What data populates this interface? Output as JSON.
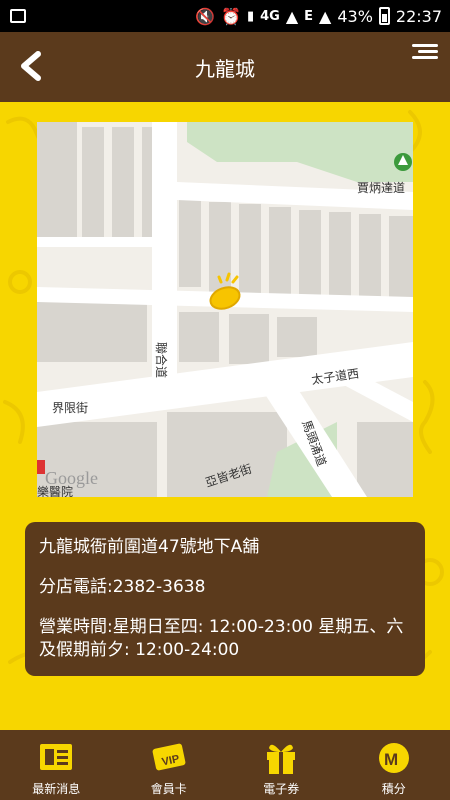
{
  "status_bar": {
    "network": "4G",
    "signal_label": "E",
    "battery": "43%",
    "time": "22:37"
  },
  "header": {
    "title": "九龍城"
  },
  "map": {
    "street_labels": [
      "賈炳達道",
      "聯合道",
      "界限街",
      "太子道西",
      "亞皆老街",
      "馬頭涌道"
    ],
    "attribution": "Google",
    "poi_partial": "樂醫院"
  },
  "shop": {
    "address": "九龍城衙前圍道47號地下A舖",
    "phone": "分店電話:2382-3638",
    "hours": "營業時間:星期日至四: 12:00-23:00 星期五、六及假期前夕: 12:00-24:00"
  },
  "bottom_nav": [
    {
      "label": "最新消息",
      "icon": "news-icon"
    },
    {
      "label": "會員卡",
      "icon": "member-card-icon"
    },
    {
      "label": "電子券",
      "icon": "gift-coupon-icon"
    },
    {
      "label": "積分",
      "icon": "points-icon"
    }
  ],
  "colors": {
    "brand_brown": "#5b3a1c",
    "brand_yellow": "#f7d600"
  }
}
